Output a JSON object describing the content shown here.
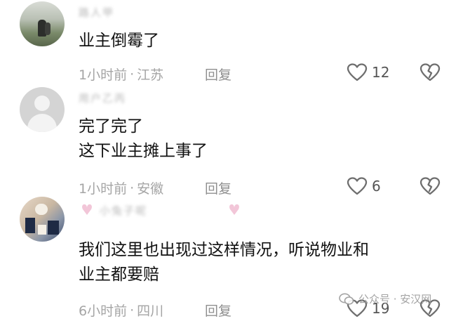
{
  "comments": [
    {
      "username": "路人甲",
      "text_lines": [
        "业主倒霉了"
      ],
      "time": "1小时前",
      "location": "江苏",
      "reply_label": "回复",
      "like_count": "12"
    },
    {
      "username": "用户乙丙",
      "text_lines": [
        "完了完了",
        "这下业主摊上事了"
      ],
      "time": "1小时前",
      "location": "安徽",
      "reply_label": "回复",
      "like_count": "6"
    },
    {
      "username": "小兔子呢",
      "text_lines": [
        "我们这里也出现过这样情况，听说物业和",
        "业主都要赔"
      ],
      "time": "6小时前",
      "location": "四川",
      "reply_label": "回复",
      "like_count": "19"
    }
  ],
  "separator": "·",
  "icons": {
    "like": "heart-outline-icon",
    "dislike": "broken-heart-icon"
  },
  "watermark": {
    "text": "公众号 · 安汉网"
  },
  "colors": {
    "meta": "#a5a5a5",
    "text": "#111111",
    "icon": "#6e6e6e",
    "deco_pink": "#f2c6d8"
  }
}
